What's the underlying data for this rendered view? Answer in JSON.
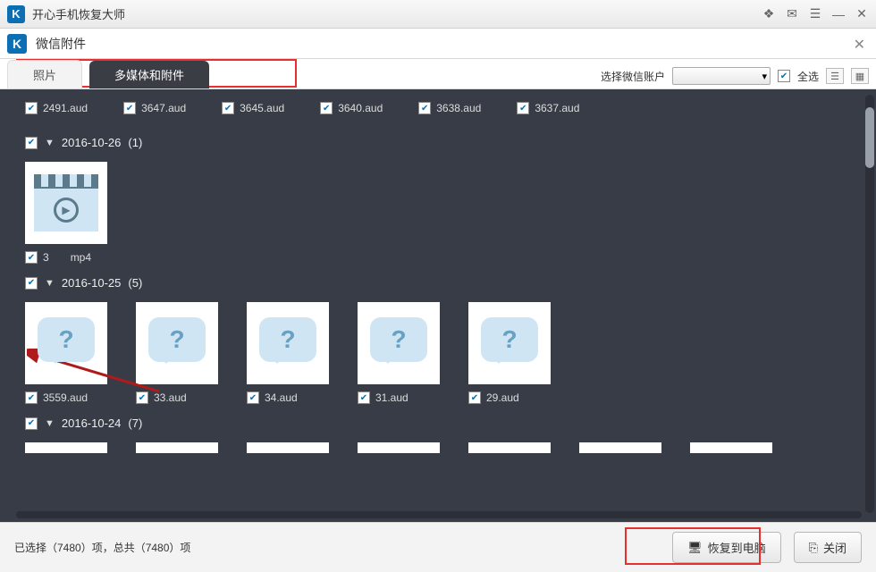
{
  "titlebar": {
    "title": "开心手机恢复大师"
  },
  "subheader": {
    "title": "微信附件"
  },
  "tabs": {
    "photos": "照片",
    "multimedia": "多媒体和附件"
  },
  "toolbar": {
    "account_label": "选择微信账户",
    "select_all": "全选"
  },
  "top_files": [
    {
      "name": "2491.aud"
    },
    {
      "name": "3647.aud"
    },
    {
      "name": "3645.aud"
    },
    {
      "name": "3640.aud"
    },
    {
      "name": "3638.aud"
    },
    {
      "name": "3637.aud"
    }
  ],
  "groups": [
    {
      "date": "2016-10-26",
      "count": "(1)",
      "items": [
        {
          "name": "3",
          "suffix": "mp4"
        }
      ]
    },
    {
      "date": "2016-10-25",
      "count": "(5)",
      "items": [
        {
          "name": "3559.aud"
        },
        {
          "name": "33.aud"
        },
        {
          "name": "34.aud"
        },
        {
          "name": "31.aud"
        },
        {
          "name": "29.aud"
        }
      ]
    },
    {
      "date": "2016-10-24",
      "count": "(7)"
    }
  ],
  "footer": {
    "status": "已选择（7480）项，总共（7480）项",
    "recover_btn": "恢复到电脑",
    "close_btn": "关闭"
  }
}
